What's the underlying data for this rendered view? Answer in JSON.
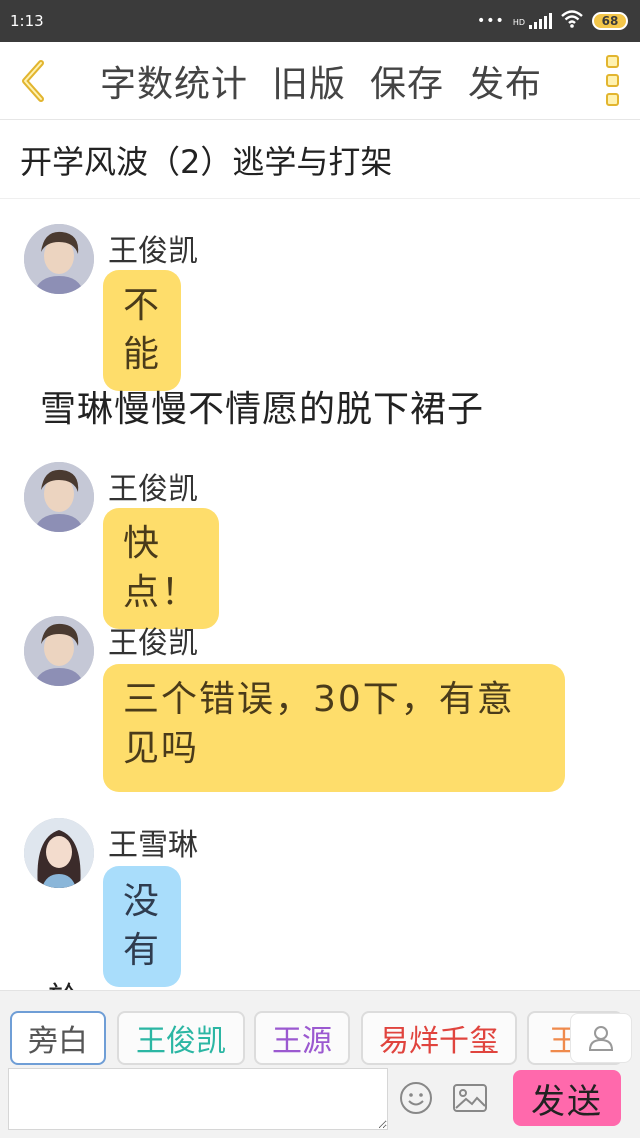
{
  "status": {
    "time": "1:13",
    "network": "HD",
    "battery": "68"
  },
  "toolbar": {
    "back_icon": "chevron-left-icon",
    "actions": [
      "字数统计",
      "旧版",
      "保存",
      "发布"
    ],
    "more_icon": "more-vertical-icon"
  },
  "title": "开学风波（2）逃学与打架",
  "messages": [
    {
      "type": "chat",
      "name": "王俊凯",
      "text": "不能",
      "color": "#fedd6b"
    },
    {
      "type": "narration",
      "text": "雪琳慢慢不情愿的脱下裙子"
    },
    {
      "type": "chat",
      "name": "王俊凯",
      "text": "快点！",
      "color": "#fedd6b"
    },
    {
      "type": "chat",
      "name": "王俊凯",
      "text": "三个错误，30下，有意见吗",
      "color": "#fedd6b"
    },
    {
      "type": "chat",
      "name": "王雪琳",
      "text": "没有",
      "color": "#a9ddfb"
    }
  ],
  "partial_text": "於",
  "roles": [
    {
      "label": "旁白",
      "color": "#555555"
    },
    {
      "label": "王俊凯",
      "color": "#2bb6a3"
    },
    {
      "label": "王源",
      "color": "#9b59d0"
    },
    {
      "label": "易烊千玺",
      "color": "#e0443e"
    },
    {
      "label": "王",
      "color": "#ef8a4c"
    }
  ],
  "input": {
    "placeholder": "",
    "send_label": "发送"
  },
  "colors": {
    "accent_yellow": "#fedd6b",
    "accent_blue": "#a9ddfb",
    "send_pink": "#ff69ac",
    "icon_gold": "#e2b52f"
  }
}
